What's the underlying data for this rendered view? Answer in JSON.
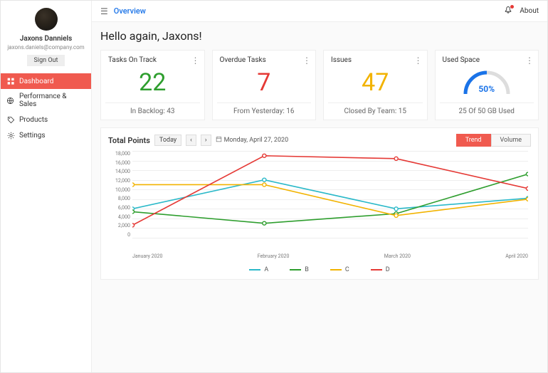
{
  "user": {
    "name": "Jaxons Danniels",
    "email": "jaxons.daniels@company.com",
    "signout_label": "Sign Out"
  },
  "nav": {
    "items": [
      {
        "label": "Dashboard",
        "icon": "grid",
        "active": true
      },
      {
        "label": "Performance & Sales",
        "icon": "globe"
      },
      {
        "label": "Products",
        "icon": "tag"
      },
      {
        "label": "Settings",
        "icon": "gear"
      }
    ]
  },
  "topbar": {
    "overview": "Overview",
    "about": "About"
  },
  "greeting": "Hello again, Jaxons!",
  "cards": [
    {
      "title": "Tasks On Track",
      "value": "22",
      "sub": "In Backlog: 43",
      "color": "#2e9e2e"
    },
    {
      "title": "Overdue Tasks",
      "value": "7",
      "sub": "From Yesterday: 16",
      "color": "#e53935"
    },
    {
      "title": "Issues",
      "value": "47",
      "sub": "Closed By Team: 15",
      "color": "#f2b300"
    },
    {
      "title": "Used Space",
      "gauge_pct": 50,
      "gauge_label": "50%",
      "sub": "25 Of 50 GB Used",
      "color": "#1a73e8"
    }
  ],
  "chart_header": {
    "title": "Total Points",
    "today_label": "Today",
    "date_label": "Monday, April 27, 2020",
    "seg": {
      "trend": "Trend",
      "volume": "Volume",
      "active": "trend"
    }
  },
  "chart_data": {
    "type": "line",
    "x": [
      "January 2020",
      "February 2020",
      "March 2020",
      "April 2020"
    ],
    "yticks": [
      0,
      2000,
      4000,
      6000,
      8000,
      10000,
      12000,
      14000,
      16000,
      18000
    ],
    "ylim": [
      0,
      18000
    ],
    "series": [
      {
        "name": "A",
        "color": "#2bb9c9",
        "values": [
          6000,
          12000,
          6000,
          8200
        ]
      },
      {
        "name": "B",
        "color": "#2e9e2e",
        "values": [
          5400,
          3000,
          5000,
          13200
        ]
      },
      {
        "name": "C",
        "color": "#f2b300",
        "values": [
          11000,
          11000,
          4600,
          8000
        ]
      },
      {
        "name": "D",
        "color": "#e53935",
        "values": [
          2600,
          17000,
          16400,
          10200
        ]
      }
    ],
    "legend_labels": [
      "A",
      "B",
      "C",
      "D"
    ]
  }
}
